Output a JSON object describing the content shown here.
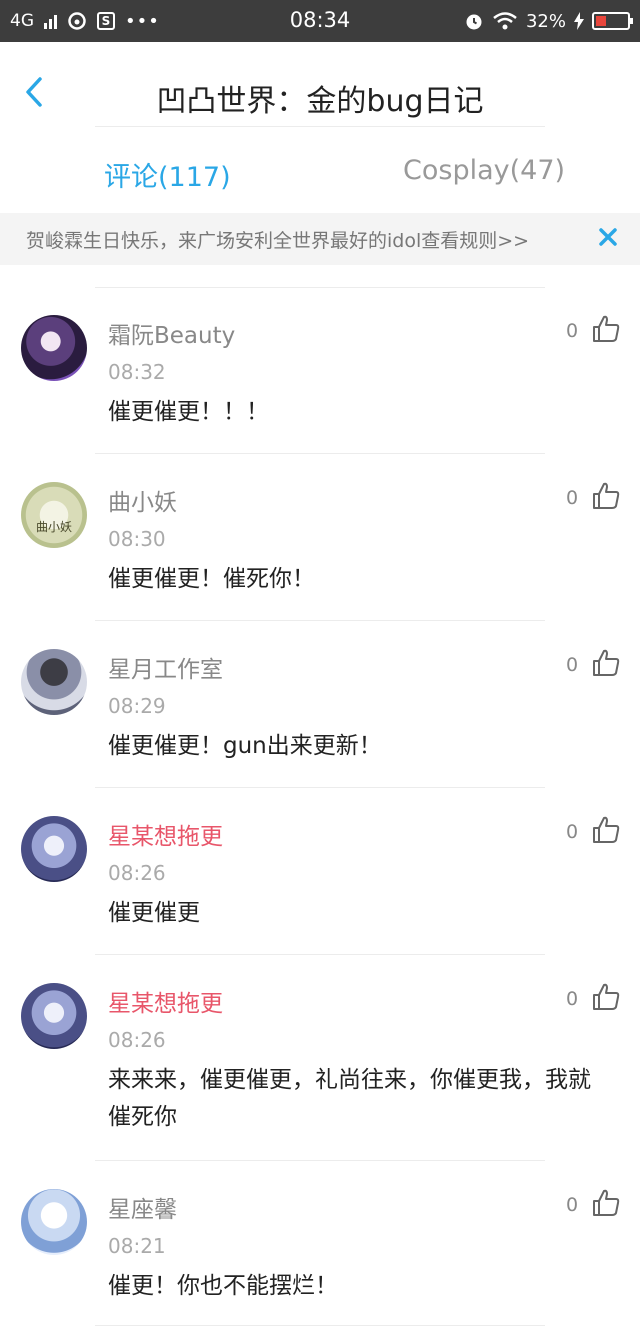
{
  "status_bar": {
    "network": "4G",
    "app_icon_glyph": "S",
    "dots": "•••",
    "time": "08:34",
    "battery_percent": "32%",
    "battery_level": 0.32,
    "icons": [
      "signal-bars-icon",
      "weibo-icon",
      "s-app-icon",
      "alarm-icon",
      "wifi-icon",
      "charging-bolt-icon",
      "battery-icon"
    ]
  },
  "header": {
    "title": "凹凸世界：金的bug日记",
    "back_icon": "chevron-left-icon"
  },
  "tabs": [
    {
      "label": "评论(117)",
      "active": true
    },
    {
      "label": "Cosplay(47)",
      "active": false
    }
  ],
  "notice": {
    "text": "贺峻霖生日快乐，来广场安利全世界最好的idol查看规则>>",
    "close_icon": "close-icon"
  },
  "colors": {
    "accent": "#2aa7e6",
    "highlight_name": "#e8566a",
    "status_bar": "#3d3d3d"
  },
  "comments": [
    {
      "name": "霜阮Beauty",
      "highlight": false,
      "time": "08:32",
      "text": "催更催更！！！",
      "likes": "0",
      "avatar": "avatar-purple-character"
    },
    {
      "name": "曲小妖",
      "highlight": false,
      "time": "08:30",
      "text": "催更催更！催死你！",
      "likes": "0",
      "avatar": "avatar-green-text-曲小妖"
    },
    {
      "name": "星月工作室",
      "highlight": false,
      "time": "08:29",
      "text": "催更催更！gun出来更新！",
      "likes": "0",
      "avatar": "avatar-dark-graffiti"
    },
    {
      "name": "星某想拖更",
      "highlight": true,
      "time": "08:26",
      "text": "催更催更",
      "likes": "0",
      "avatar": "avatar-blue-character"
    },
    {
      "name": "星某想拖更",
      "highlight": true,
      "time": "08:26",
      "text": "来来来，催更催更，礼尚往来，你催更我，我就催死你",
      "likes": "0",
      "avatar": "avatar-blue-character"
    },
    {
      "name": "星座馨",
      "highlight": false,
      "time": "08:21",
      "text": "催更！你也不能摆烂！",
      "likes": "0",
      "avatar": "avatar-white-hair-character"
    }
  ]
}
